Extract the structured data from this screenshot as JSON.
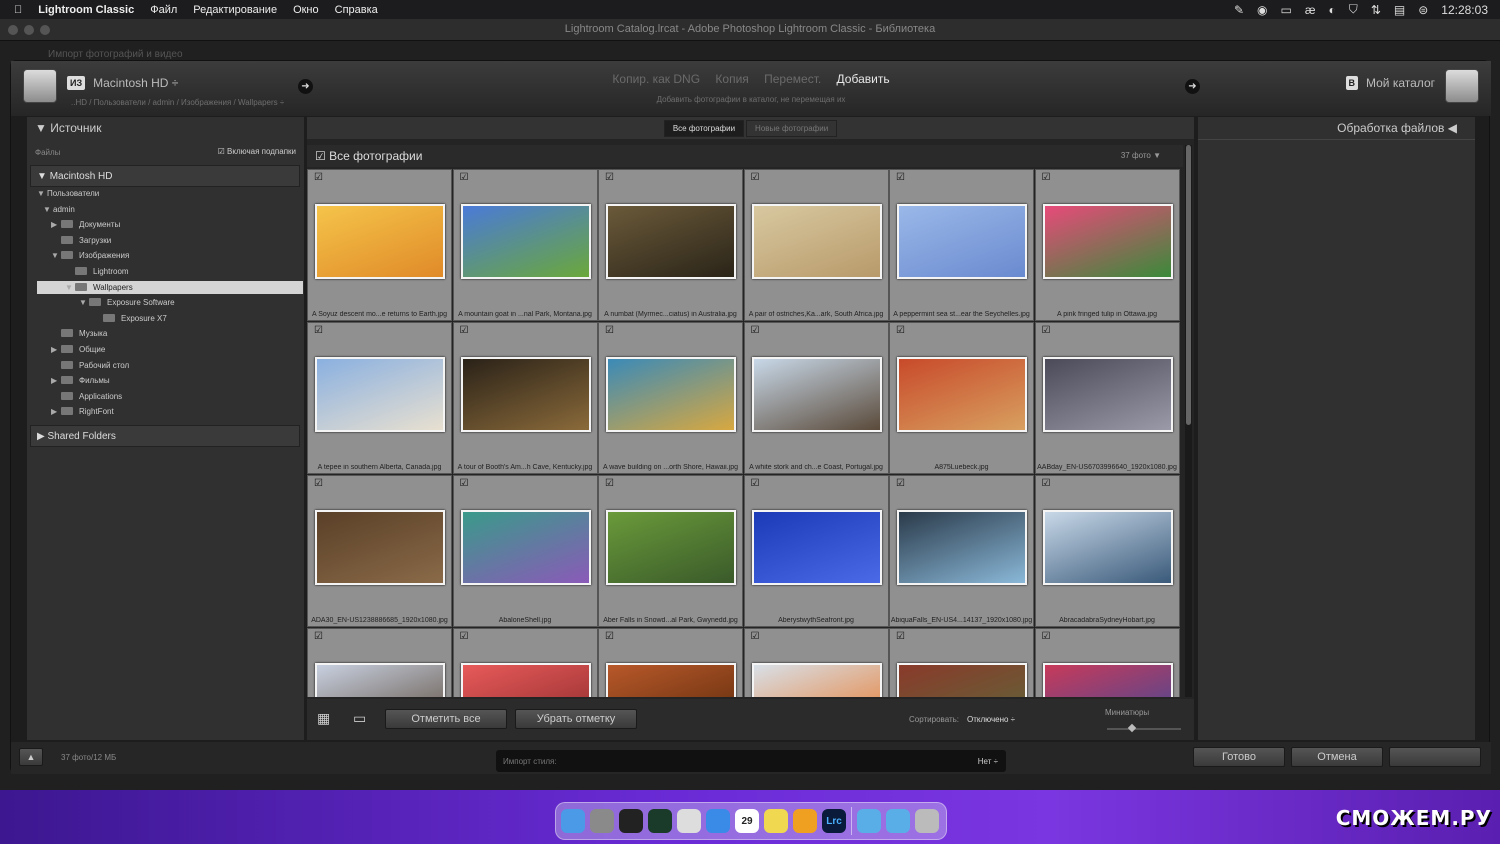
{
  "menubar": {
    "app": "Lightroom Classic",
    "items": [
      "Файл",
      "Редактирование",
      "Окно",
      "Справка"
    ],
    "clock": "12:28:03"
  },
  "window": {
    "title": "Lightroom Catalog.lrcat - Adobe Photoshop Lightroom Classic - Библиотека",
    "subtitle": "Импорт фотографий и видео"
  },
  "header": {
    "from_badge": "ИЗ",
    "source": "Macintosh HD ÷",
    "path": "..HD / Пользователи / admin / Изображения / Wallpapers ÷",
    "modes": [
      "Копир. как DNG",
      "Копия",
      "Перемест.",
      "Добавить"
    ],
    "active_mode": "Добавить",
    "mode_desc": "Добавить фотографии в каталог, не перемещая их",
    "to_badge": "В",
    "destination": "Мой каталог"
  },
  "source_panel": {
    "title": "Источник",
    "files_label": "Файлы",
    "include_sub": "Включая подпапки",
    "volume": "Macintosh HD",
    "shared": "Shared Folders",
    "tree": [
      {
        "label": "Пользователи",
        "tri": "▼",
        "folder": false
      },
      {
        "label": "admin",
        "tri": "▼",
        "folder": false
      },
      {
        "label": "Документы",
        "tri": "▶",
        "folder": true
      },
      {
        "label": "Загрузки",
        "tri": "",
        "folder": true
      },
      {
        "label": "Изображения",
        "tri": "▼",
        "folder": true
      },
      {
        "label": "Lightroom",
        "tri": "",
        "folder": true
      },
      {
        "label": "Wallpapers",
        "tri": "▼",
        "folder": true,
        "selected": true
      },
      {
        "label": "Exposure Software",
        "tri": "▼",
        "folder": true
      },
      {
        "label": "Exposure X7",
        "tri": "",
        "folder": true
      },
      {
        "label": "Музыка",
        "tri": "",
        "folder": true
      },
      {
        "label": "Общие",
        "tri": "▶",
        "folder": true
      },
      {
        "label": "Рабочий стол",
        "tri": "",
        "folder": true
      },
      {
        "label": "Фильмы",
        "tri": "▶",
        "folder": true
      },
      {
        "label": "Applications",
        "tri": "",
        "folder": true
      },
      {
        "label": "RightFont",
        "tri": "▶",
        "folder": true
      }
    ]
  },
  "grid": {
    "tabs": [
      "Все фотографии",
      "Новые фотографии"
    ],
    "title": "Все фотографии",
    "count": "37 фото",
    "photos": [
      {
        "caption": "A Soyuz descent mo...e returns to Earth.jpg",
        "colors": [
          "#f5c44a",
          "#e08a28"
        ]
      },
      {
        "caption": "A mountain goat in ...nal Park, Montana.jpg",
        "colors": [
          "#4a7ad8",
          "#6ba83a"
        ]
      },
      {
        "caption": "A numbat (Myrmec...ciatus) in Australia.jpg",
        "colors": [
          "#6b5a3a",
          "#2a2418"
        ]
      },
      {
        "caption": "A pair of ostriches,Ka...ark, South Africa.jpg",
        "colors": [
          "#d8c8a0",
          "#b89a6a"
        ]
      },
      {
        "caption": "A peppermint sea st...ear the Seychelles.jpg",
        "colors": [
          "#9ab8e8",
          "#6a8ad0"
        ]
      },
      {
        "caption": "A pink fringed tulip in Ottawa.jpg",
        "colors": [
          "#e84a7a",
          "#3a8a3a"
        ]
      },
      {
        "caption": "A tepee in southern Alberta, Canada.jpg",
        "colors": [
          "#8ab0e0",
          "#e8e0d0"
        ]
      },
      {
        "caption": "A tour of Booth's Am...h Cave, Kentucky.jpg",
        "colors": [
          "#2a2218",
          "#8a6a3a"
        ]
      },
      {
        "caption": "A wave building on ...orth Shore, Hawaii.jpg",
        "colors": [
          "#3a8ab8",
          "#d8a840"
        ]
      },
      {
        "caption": "A white stork and ch...e Coast, Portugal.jpg",
        "colors": [
          "#c8d8e8",
          "#5a4a3a"
        ]
      },
      {
        "caption": "A875Luebeck.jpg",
        "colors": [
          "#c84a2a",
          "#d8a060"
        ]
      },
      {
        "caption": "AABday_EN-US6703996640_1920x1080.jpg",
        "colors": [
          "#4a4a58",
          "#9a9aa8"
        ]
      },
      {
        "caption": "ADA30_EN-US1238886685_1920x1080.jpg",
        "colors": [
          "#5a4028",
          "#8a6a48"
        ]
      },
      {
        "caption": "AbaloneShell.jpg",
        "colors": [
          "#3a9a8a",
          "#8a5ab8"
        ]
      },
      {
        "caption": "Aber Falls in Snowd...al Park, Gwynedd.jpg",
        "colors": [
          "#6a9a3a",
          "#3a5a2a"
        ]
      },
      {
        "caption": "AberystwythSeafront.jpg",
        "colors": [
          "#1a3ab8",
          "#4a6ae8"
        ]
      },
      {
        "caption": "AbiquaFalls_EN-US4...14137_1920x1080.jpg",
        "colors": [
          "#2a3a4a",
          "#8ab8d8"
        ]
      },
      {
        "caption": "AbracadabraSydneyHobart.jpg",
        "colors": [
          "#c8d8e8",
          "#3a5a7a"
        ]
      },
      {
        "caption": "",
        "colors": [
          "#c8d0e0",
          "#5a4a3a"
        ]
      },
      {
        "caption": "",
        "colors": [
          "#e85a5a",
          "#8a2a2a"
        ]
      },
      {
        "caption": "",
        "colors": [
          "#b8582a",
          "#5a2a0a"
        ]
      },
      {
        "caption": "",
        "colors": [
          "#d8e0e8",
          "#e8782a"
        ]
      },
      {
        "caption": "",
        "colors": [
          "#8a3a2a",
          "#5a6a3a"
        ]
      },
      {
        "caption": "",
        "colors": [
          "#c83a5a",
          "#3a4a9a"
        ]
      }
    ],
    "check_all": "Отметить все",
    "uncheck_all": "Убрать отметку",
    "sort_label": "Сортировать:",
    "sort_value": "Отключено ÷",
    "thumbs_label": "Миниатюры"
  },
  "right_panel": {
    "title": "Обработка файлов"
  },
  "footer": {
    "summary": "37 фото/12 МБ",
    "preset_label": "Импорт стиля:",
    "preset_value": "Нет ÷",
    "done": "Готово",
    "cancel": "Отмена"
  },
  "dock": {
    "calendar_day": "29",
    "lrc": "Lrc",
    "apps": [
      {
        "name": "finder-icon",
        "color": "#4a9ae8"
      },
      {
        "name": "settings-icon",
        "color": "#8a8a8a"
      },
      {
        "name": "terminal-icon",
        "color": "#222"
      },
      {
        "name": "activity-monitor-icon",
        "color": "#1a3a2a"
      },
      {
        "name": "script-editor-icon",
        "color": "#ddd"
      },
      {
        "name": "safari-icon",
        "color": "#3a8ae8"
      },
      {
        "name": "calendar-icon",
        "color": "#fff"
      },
      {
        "name": "notes-icon",
        "color": "#f0d850"
      },
      {
        "name": "font-app-icon",
        "color": "#f0a020"
      },
      {
        "name": "lightroom-classic-icon",
        "color": "#0a1a3a"
      },
      {
        "name": "screenshot-folder-icon",
        "color": "#5aaee8"
      },
      {
        "name": "apps-folder-icon",
        "color": "#5aaee8"
      },
      {
        "name": "trash-icon",
        "color": "#bbb"
      }
    ]
  },
  "watermark": "СМОЖЕМ.РУ"
}
